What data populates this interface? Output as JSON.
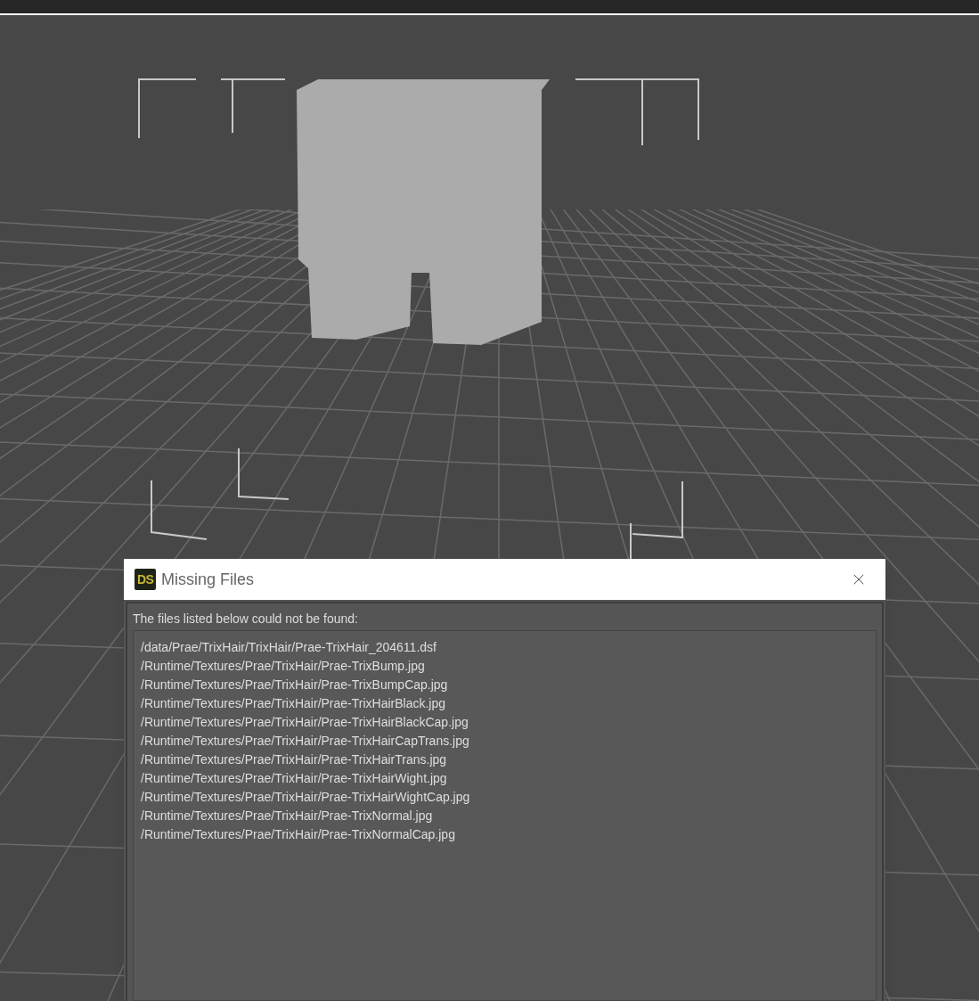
{
  "dialog": {
    "logo_text": "DS",
    "title": "Missing Files",
    "message": "The files listed below could not be found:",
    "files": [
      "/data/Prae/TrixHair/TrixHair/Prae-TrixHair_204611.dsf",
      "/Runtime/Textures/Prae/TrixHair/Prae-TrixBump.jpg",
      "/Runtime/Textures/Prae/TrixHair/Prae-TrixBumpCap.jpg",
      "/Runtime/Textures/Prae/TrixHair/Prae-TrixHairBlack.jpg",
      "/Runtime/Textures/Prae/TrixHair/Prae-TrixHairBlackCap.jpg",
      "/Runtime/Textures/Prae/TrixHair/Prae-TrixHairCapTrans.jpg",
      "/Runtime/Textures/Prae/TrixHair/Prae-TrixHairTrans.jpg",
      "/Runtime/Textures/Prae/TrixHair/Prae-TrixHairWight.jpg",
      "/Runtime/Textures/Prae/TrixHair/Prae-TrixHairWightCap.jpg",
      "/Runtime/Textures/Prae/TrixHair/Prae-TrixNormal.jpg",
      "/Runtime/Textures/Prae/TrixHair/Prae-TrixNormalCap.jpg"
    ]
  }
}
